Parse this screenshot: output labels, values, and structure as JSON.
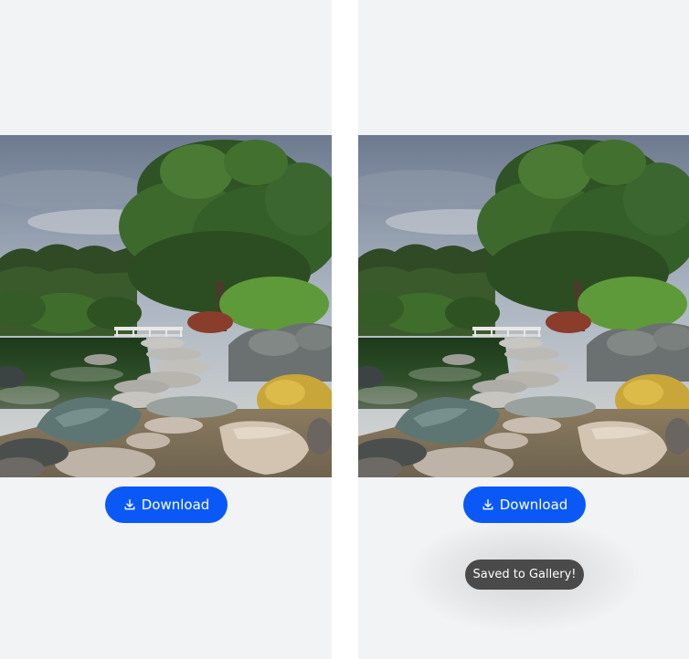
{
  "screens": [
    {
      "download_button": {
        "label": "Download",
        "icon": "download-icon"
      }
    },
    {
      "download_button": {
        "label": "Download",
        "icon": "download-icon"
      },
      "toast": {
        "message": "Saved to Gallery!"
      }
    }
  ],
  "colors": {
    "background": "#f1f3f5",
    "accent": "#0a59f7",
    "toast_background": "#4a4a4a"
  }
}
